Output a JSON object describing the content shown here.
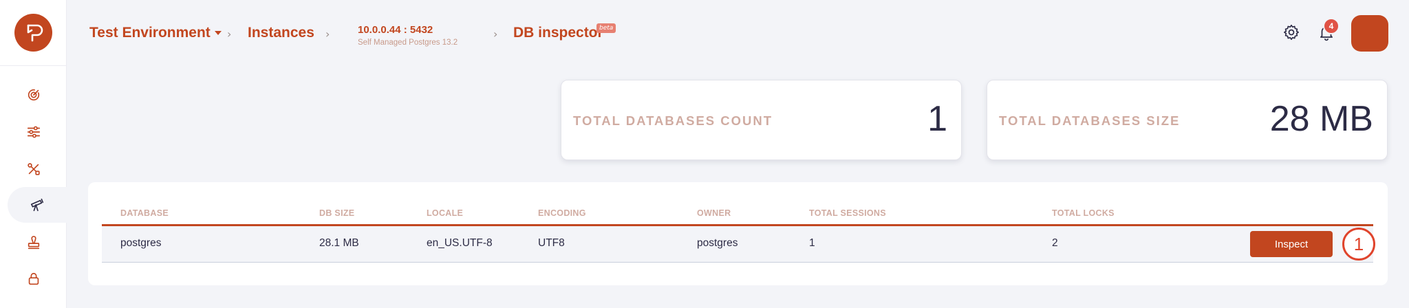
{
  "sidebar": {
    "items": [
      {
        "icon": "radar-icon"
      },
      {
        "icon": "sliders-icon"
      },
      {
        "icon": "tools-icon"
      },
      {
        "icon": "telescope-icon",
        "active": true
      },
      {
        "icon": "stamp-icon"
      },
      {
        "icon": "lock-icon"
      }
    ]
  },
  "header": {
    "environment": "Test Environment",
    "instances": "Instances",
    "instance_address": "10.0.0.44 : 5432",
    "instance_type": "Self Managed Postgres 13.2",
    "page": "DB inspector",
    "page_badge": "beta",
    "notification_count": "4"
  },
  "stats": {
    "count_label": "TOTAL DATABASES COUNT",
    "count_value": "1",
    "size_label": "TOTAL DATABASES SIZE",
    "size_value": "28 MB"
  },
  "table": {
    "columns": [
      "DATABASE",
      "DB SIZE",
      "LOCALE",
      "ENCODING",
      "OWNER",
      "TOTAL SESSIONS",
      "TOTAL LOCKS"
    ],
    "rows": [
      {
        "database": "postgres",
        "db_size": "28.1 MB",
        "locale": "en_US.UTF-8",
        "encoding": "UTF8",
        "owner": "postgres",
        "total_sessions": "1",
        "total_locks": "2"
      }
    ],
    "inspect_label": "Inspect",
    "annotation": "1"
  },
  "colors": {
    "accent": "#c2461f",
    "badge": "#e05245",
    "muted_label": "#d0aba1",
    "background": "#f3f4f8"
  }
}
